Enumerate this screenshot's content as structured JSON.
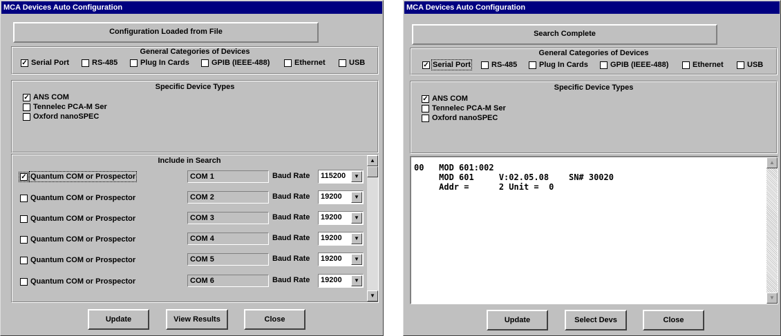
{
  "left": {
    "title": "MCA Devices Auto Configuration",
    "status": "Configuration Loaded from File",
    "general": {
      "title": "General Categories of Devices",
      "items": [
        {
          "label": "Serial Port",
          "checked": "☑"
        },
        {
          "label": "RS-485",
          "checked": ""
        },
        {
          "label": "Plug In Cards",
          "checked": ""
        },
        {
          "label": "GPIB (IEEE-488)",
          "checked": ""
        },
        {
          "label": "Ethernet",
          "checked": ""
        },
        {
          "label": "USB",
          "checked": ""
        }
      ]
    },
    "specific": {
      "title": "Specific Device Types",
      "items": [
        {
          "label": "ANS COM",
          "checked": true
        },
        {
          "label": "Tennelec PCA-M Ser",
          "checked": false
        },
        {
          "label": "Oxford nanoSPEC",
          "checked": false
        }
      ]
    },
    "search": {
      "title": "Include in Search",
      "baud_label": "Baud Rate",
      "rows": [
        {
          "label": "Quantum COM or Prospector",
          "checked": true,
          "port": "COM 1",
          "baud": "115200"
        },
        {
          "label": "Quantum COM or Prospector",
          "checked": false,
          "port": "COM 2",
          "baud": "19200"
        },
        {
          "label": "Quantum COM or Prospector",
          "checked": false,
          "port": "COM 3",
          "baud": "19200"
        },
        {
          "label": "Quantum COM or Prospector",
          "checked": false,
          "port": "COM 4",
          "baud": "19200"
        },
        {
          "label": "Quantum COM or Prospector",
          "checked": false,
          "port": "COM 5",
          "baud": "19200"
        },
        {
          "label": "Quantum COM or Prospector",
          "checked": false,
          "port": "COM 6",
          "baud": "19200"
        }
      ]
    },
    "buttons": {
      "update": "Update",
      "view_results": "View Results",
      "close": "Close"
    }
  },
  "right": {
    "title": "MCA Devices Auto Configuration",
    "status": "Search Complete",
    "general": {
      "title": "General Categories of Devices",
      "items": [
        {
          "label": "Serial Port",
          "checked": true
        },
        {
          "label": "RS-485",
          "checked": false
        },
        {
          "label": "Plug In Cards",
          "checked": false
        },
        {
          "label": "GPIB (IEEE-488)",
          "checked": false
        },
        {
          "label": "Ethernet",
          "checked": false
        },
        {
          "label": "USB",
          "checked": false
        }
      ]
    },
    "specific": {
      "title": "Specific Device Types",
      "items": [
        {
          "label": "ANS COM",
          "checked": true
        },
        {
          "label": "Tennelec PCA-M Ser",
          "checked": false
        },
        {
          "label": "Oxford nanoSPEC",
          "checked": false
        }
      ]
    },
    "results": {
      "lines": [
        "00   MOD 601:002",
        "     MOD 601     V:02.05.08    SN# 30020",
        "     Addr =      2 Unit =  0"
      ]
    },
    "buttons": {
      "update": "Update",
      "select_devs": "Select Devs",
      "close": "Close"
    }
  },
  "icons": {
    "check": "check-mark",
    "down": "down-arrow",
    "up": "up-arrow"
  }
}
